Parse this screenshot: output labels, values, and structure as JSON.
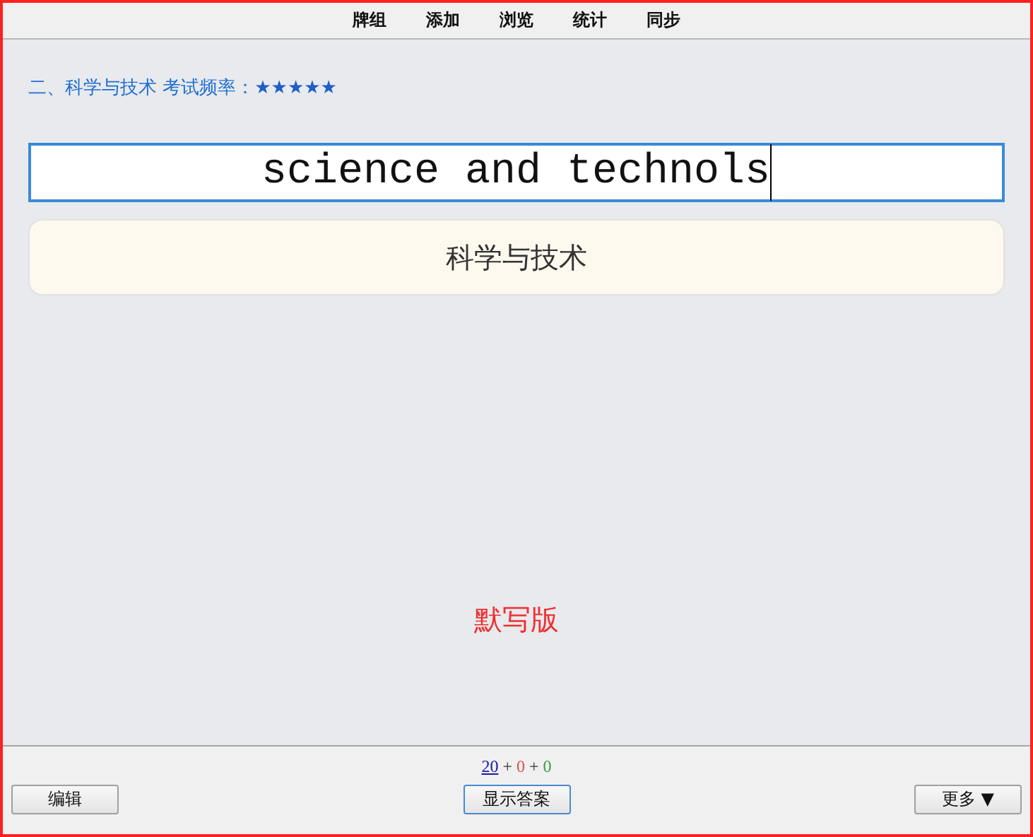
{
  "nav": [
    "牌组",
    "添加",
    "浏览",
    "统计",
    "同步"
  ],
  "card": {
    "heading": "二、科学与技术 考试频率：",
    "stars": 5,
    "answer_value": "science and technols",
    "question": "科学与技术",
    "mode_label": "默写版"
  },
  "counts": [
    {
      "value": "20",
      "color": "#1a1aa6"
    },
    {
      "value": "0",
      "color": "#d9534f"
    },
    {
      "value": "0",
      "color": "#3aa040"
    }
  ],
  "separators": [
    "+",
    "+"
  ],
  "buttons": {
    "left": "编辑",
    "center": "显示答案",
    "right": "更多 ▼"
  }
}
